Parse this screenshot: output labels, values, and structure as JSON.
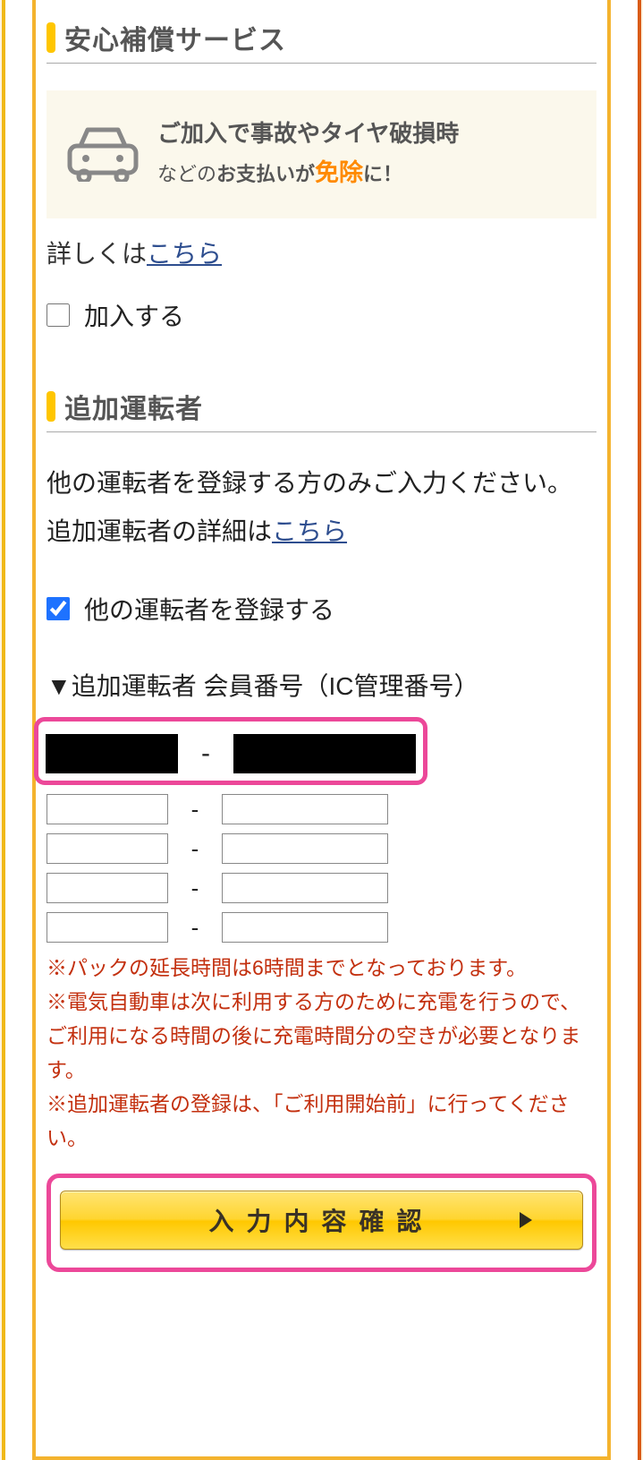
{
  "section1": {
    "heading": "安心補償サービス",
    "callout_line1": "ご加入で事故やタイヤ破損時",
    "callout_line2_a": "などの",
    "callout_line2_b": "お支払いが",
    "callout_line2_c": "免除",
    "callout_line2_d": "に！",
    "detail_prefix": "詳しくは",
    "detail_link": "こちら",
    "checkbox_label": "加入する"
  },
  "section2": {
    "heading": "追加運転者",
    "intro_a": "他の運転者を登録する方のみご入力ください。追加運転者の詳細は",
    "intro_link": "こちら",
    "checkbox_label": "他の運転者を登録する",
    "member_label": "▼追加運転者 会員番号（IC管理番号）",
    "dash": "-",
    "rows": [
      {
        "a": "",
        "b": ""
      },
      {
        "a": "",
        "b": ""
      },
      {
        "a": "",
        "b": ""
      },
      {
        "a": "",
        "b": ""
      }
    ]
  },
  "notes": {
    "n1": "※パックの延長時間は6時間までとなっております。",
    "n2": "※電気自動車は次に利用する方のために充電を行うので、ご利用になる時間の後に充電時間分の空きが必要となります。",
    "n3": "※追加運転者の登録は、「ご利用開始前」に行ってください。"
  },
  "confirm": {
    "label": "入力内容確認"
  }
}
